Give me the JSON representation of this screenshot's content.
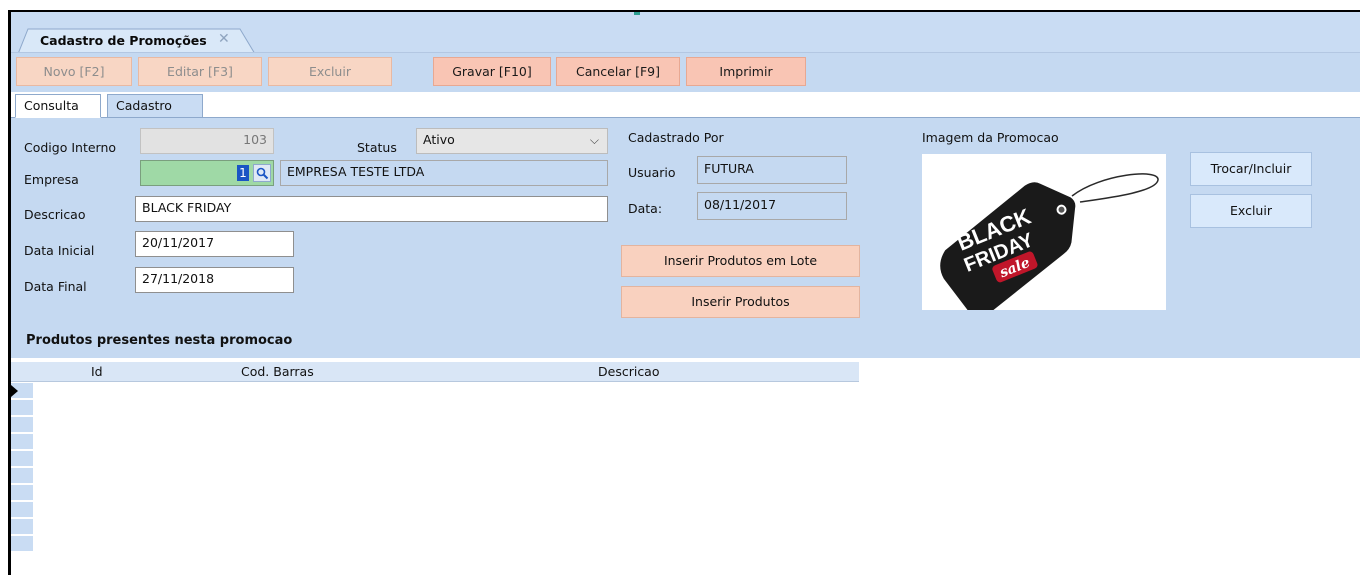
{
  "document_tab": {
    "title": "Cadastro de Promoções",
    "close_glyph": "✕"
  },
  "toolbar": {
    "novo": "Novo [F2]",
    "editar": "Editar [F3]",
    "excluir": "Excluir",
    "gravar": "Gravar [F10]",
    "cancelar": "Cancelar [F9]",
    "imprimir": "Imprimir"
  },
  "tabs": {
    "consulta": "Consulta",
    "cadastro": "Cadastro"
  },
  "form": {
    "codigo_interno_label": "Codigo Interno",
    "codigo_interno_value": "103",
    "status_label": "Status",
    "status_value": "Ativo",
    "empresa_label": "Empresa",
    "empresa_code": "1",
    "empresa_name": "EMPRESA TESTE LTDA",
    "descricao_label": "Descricao",
    "descricao_value": "BLACK FRIDAY",
    "data_inicial_label": "Data Inicial",
    "data_inicial_value": "20/11/2017",
    "data_final_label": "Data Final",
    "data_final_value": "27/11/2018"
  },
  "cadastrado_por": {
    "heading": "Cadastrado Por",
    "usuario_label": "Usuario",
    "usuario_value": "FUTURA",
    "data_label": "Data:",
    "data_value": "08/11/2017"
  },
  "actions": {
    "inserir_lote": "Inserir Produtos em Lote",
    "inserir": "Inserir Produtos"
  },
  "imagem": {
    "heading": "Imagem da Promocao",
    "trocar": "Trocar/Incluir",
    "excluir": "Excluir",
    "tag_line1": "BLACK",
    "tag_line2": "FRIDAY",
    "tag_line3": "sale"
  },
  "grid": {
    "title": "Produtos presentes nesta promocao",
    "columns": [
      "Id",
      "Cod. Barras",
      "Descricao"
    ]
  },
  "colors": {
    "panel": "#c5d9f1",
    "button_disabled": "#f8d6c4",
    "button_enabled": "#f9c5b4",
    "empresa_code_bg": "#9fd9a6"
  }
}
